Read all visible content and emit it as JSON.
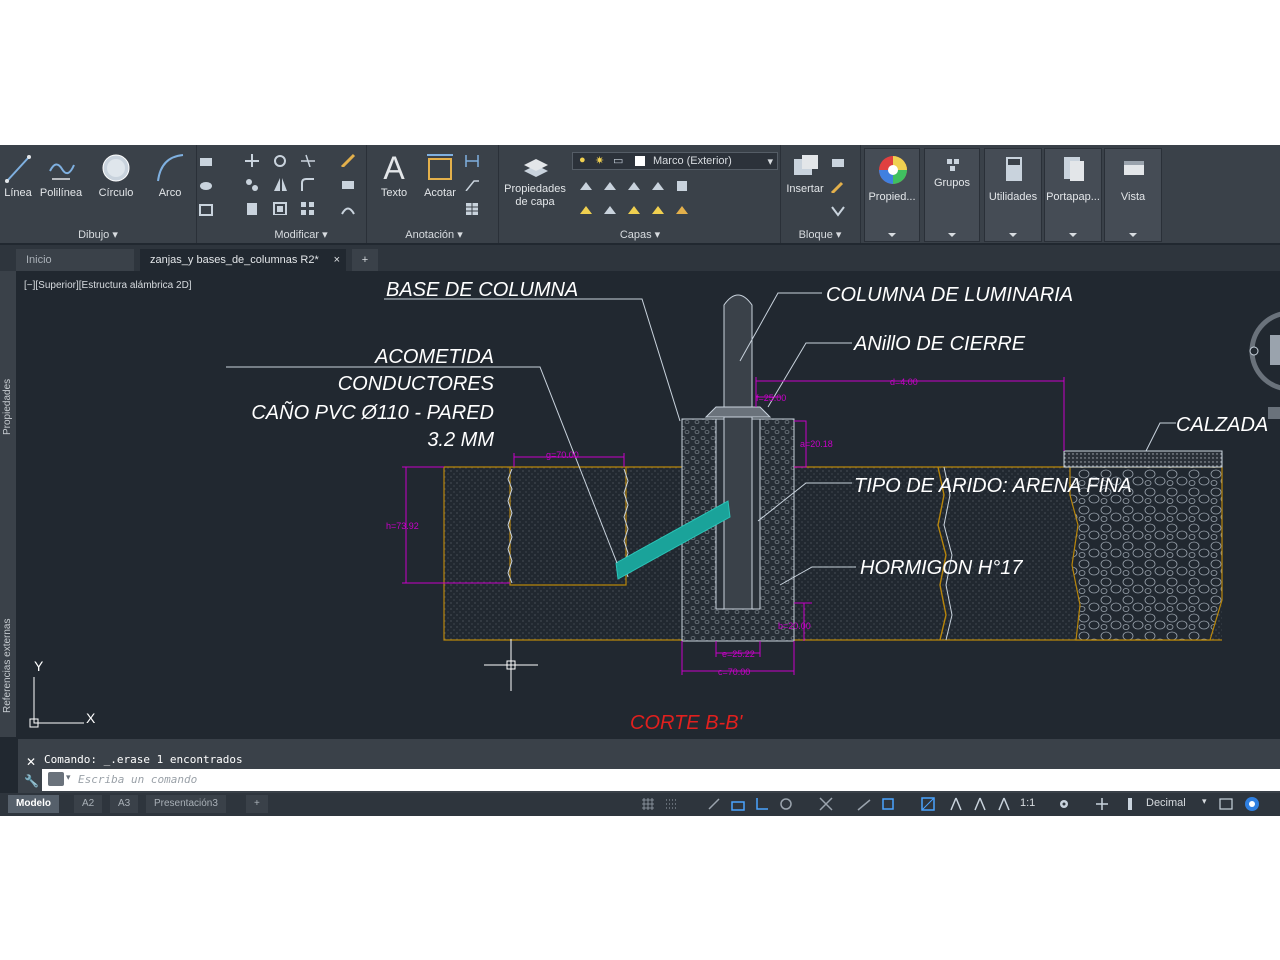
{
  "ribbon": {
    "draw": {
      "title": "Dibujo",
      "linea": "Línea",
      "polilinea": "Polilínea",
      "circulo": "Círculo",
      "arco": "Arco"
    },
    "modify": {
      "title": "Modificar"
    },
    "annotation": {
      "title": "Anotación",
      "texto": "Texto",
      "acotar": "Acotar"
    },
    "layers": {
      "title": "Capas",
      "propiedades_de_capa_line1": "Propiedades",
      "propiedades_de_capa_line2": "de capa",
      "current_layer": "Marco (Exterior)"
    },
    "block": {
      "title": "Bloque",
      "insertar": "Insertar"
    },
    "propiedades": "Propied...",
    "grupos": "Grupos",
    "utilidades": "Utilidades",
    "portapapeles": "Portapap...",
    "vista": "Vista"
  },
  "tabs": {
    "inicio": "Inicio",
    "file": "zanjas_y bases_de_columnas R2*",
    "close": "×",
    "plus": "+"
  },
  "viewport_label": "[−][Superior][Estructura alámbrica 2D]",
  "side_palettes": {
    "propiedades": "Propiedades",
    "referencias": "Referencias externas"
  },
  "drawing": {
    "labels": {
      "base_columna": "BASE DE COLUMNA",
      "acometida_1": "ACOMETIDA",
      "acometida_2": "CONDUCTORES",
      "acometida_3": "CAÑO PVC Ø110 - PARED",
      "acometida_4": "3.2 MM",
      "columna_luminaria": "COLUMNA DE LUMINARIA",
      "anillo": "ANillO DE CIERRE",
      "calzada": "CALZADA",
      "arido": "TIPO DE ARIDO: ARENA FINA",
      "hormigon": "HORMIGON H°17",
      "corte": "CORTE B-B'"
    },
    "dimensions": {
      "g": "g=70.00",
      "h": "h=73.92",
      "d": "d=4.00",
      "f": "f=25.00",
      "a": "a=20.18",
      "b": "b=20.00",
      "e": "e=25.22",
      "c": "c=70.00"
    },
    "ucs_x": "X",
    "ucs_y": "Y",
    "colors": {
      "dimension": "#c800c8",
      "soil": "#b8860b",
      "pipe": "#1aa39a",
      "corte": "#e0201e"
    }
  },
  "command_line": {
    "history": "Comando: _.erase 1 encontrados",
    "placeholder": "Escriba un comando",
    "prompt_icon": "command-prompt-icon"
  },
  "layout_tabs": [
    "Modelo",
    "A2",
    "A3",
    "Presentación3"
  ],
  "layout_plus": "+",
  "status": {
    "scale": "1:1",
    "units": "Decimal"
  }
}
